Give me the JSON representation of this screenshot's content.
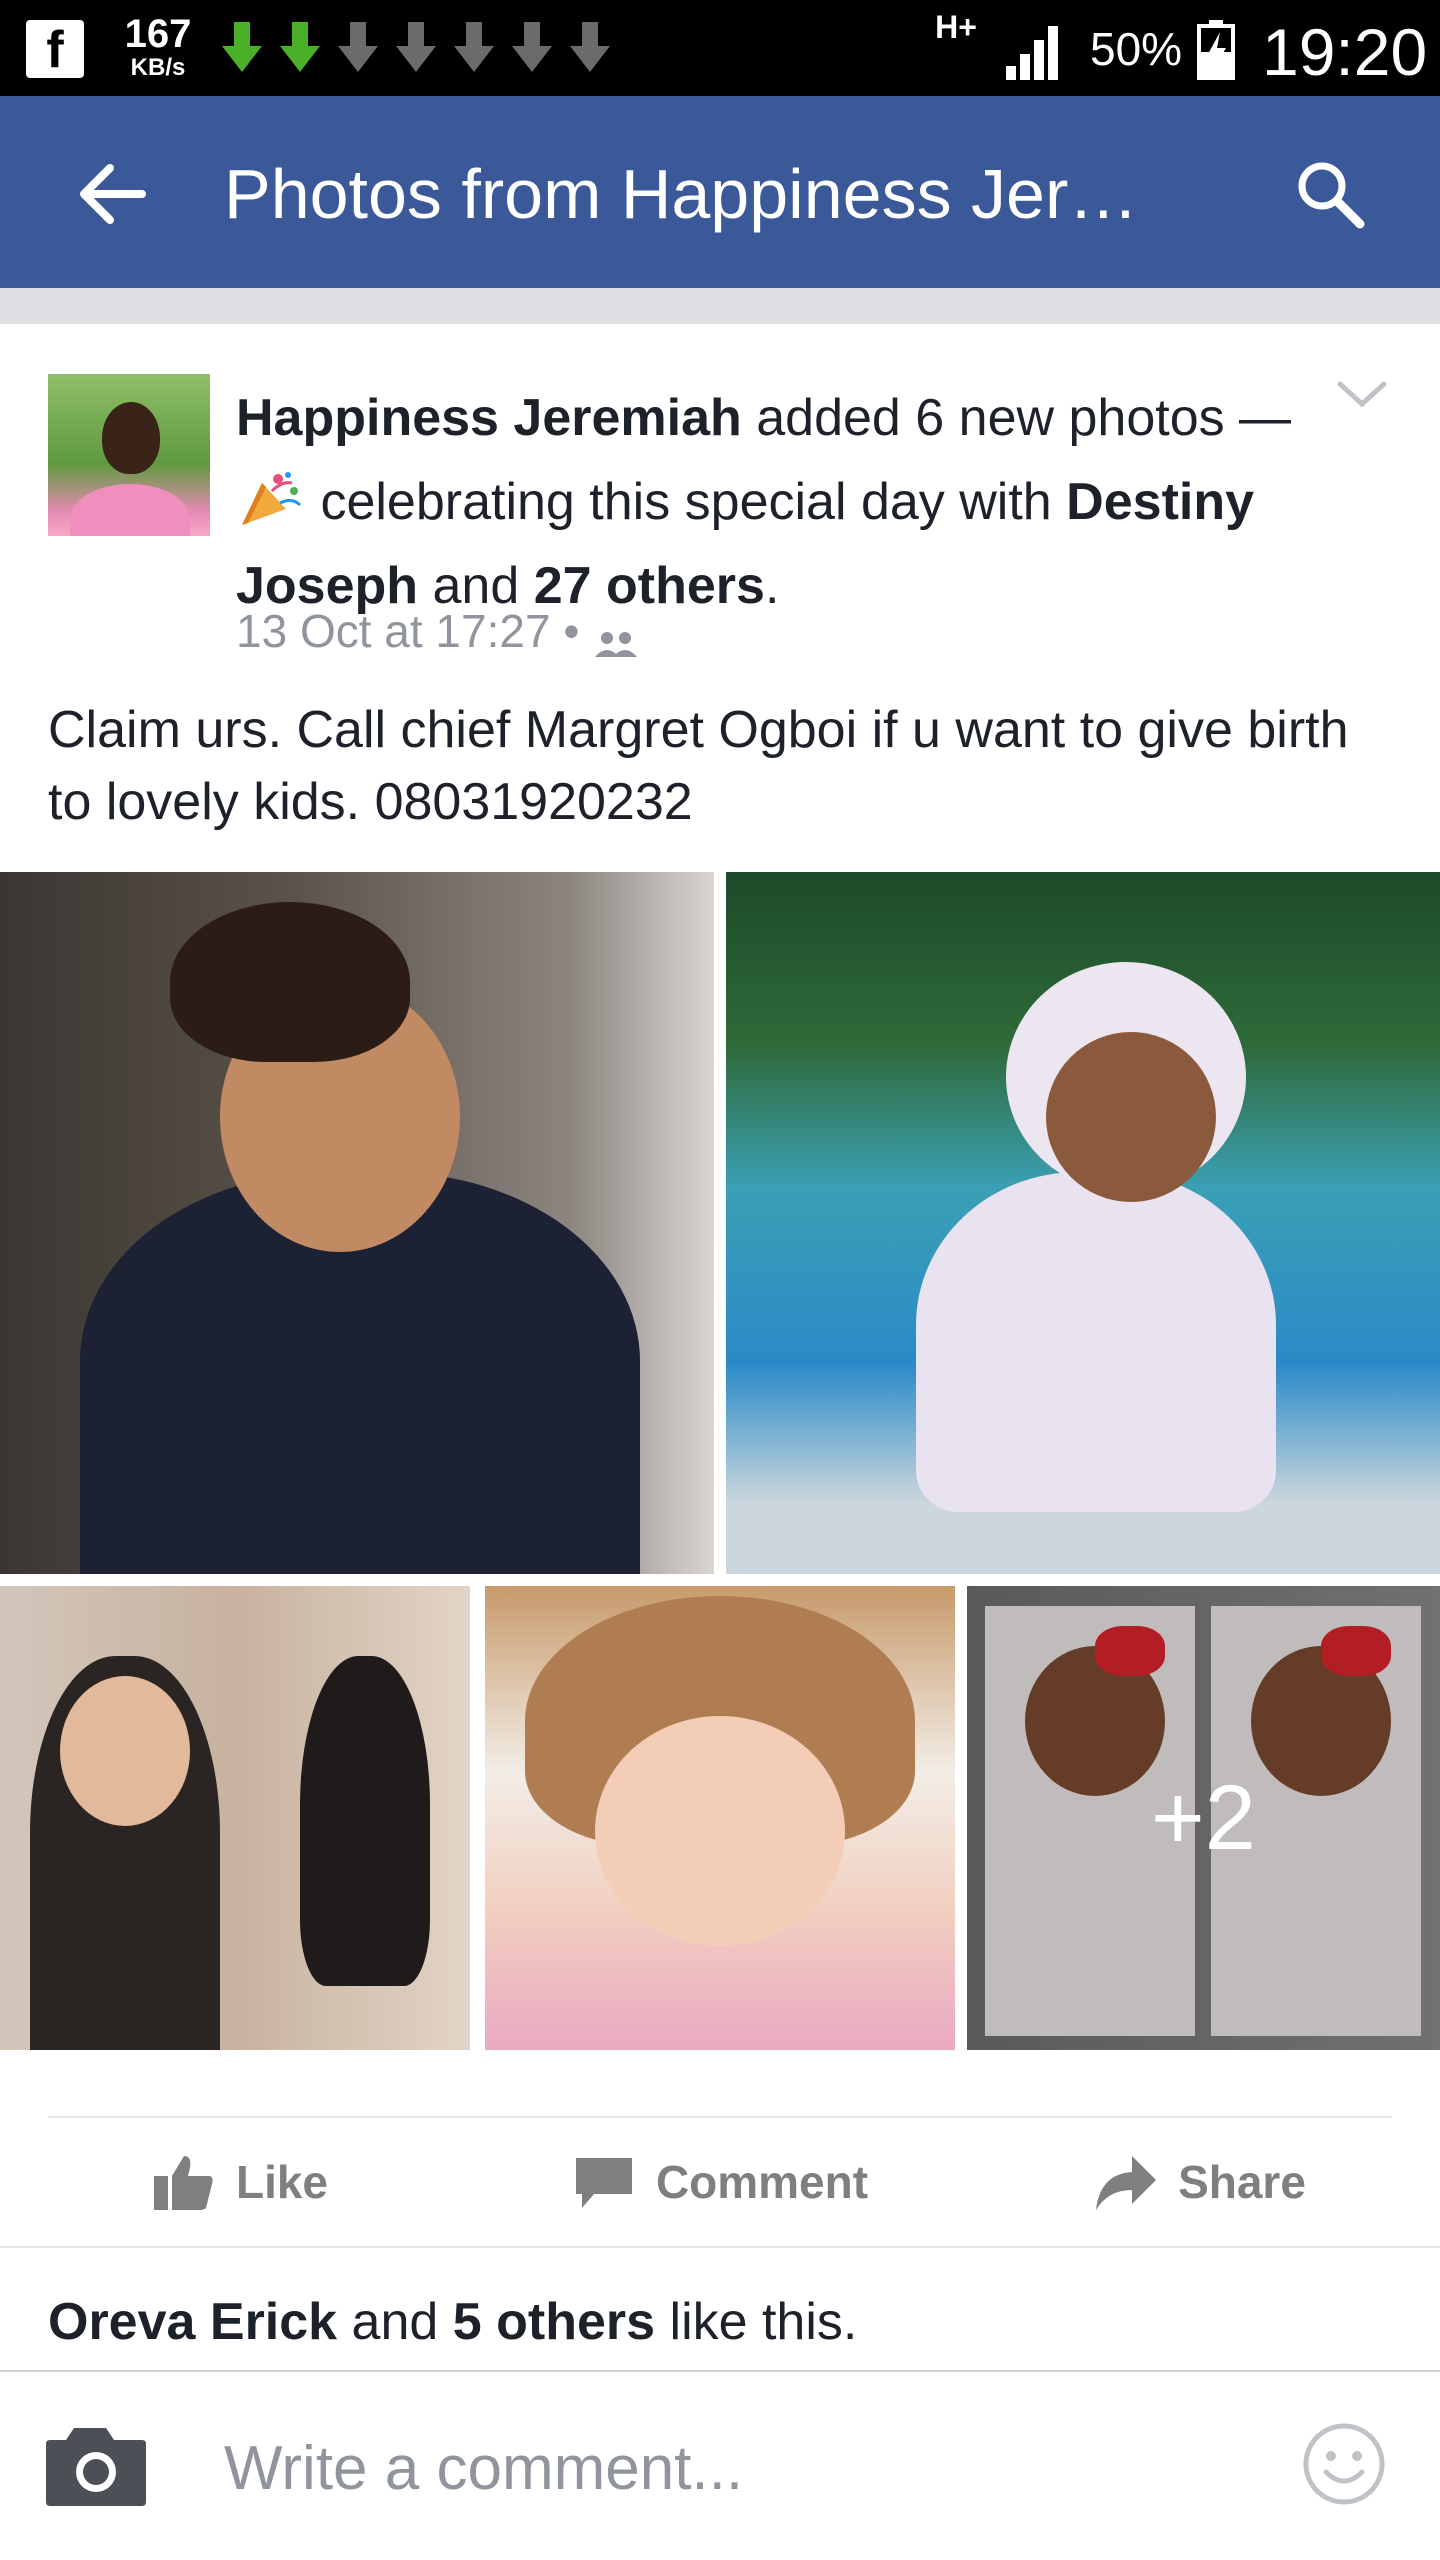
{
  "status_bar": {
    "fb_icon": "f",
    "speed_value": "167",
    "speed_unit": "KB/s",
    "network_type": "H+",
    "battery_percent": "50%",
    "time": "19:20",
    "download_arrows": [
      "green",
      "green",
      "gray",
      "gray",
      "gray",
      "gray",
      "gray"
    ],
    "accent_green": "#4caf28",
    "dim_gray": "#6b6b6b"
  },
  "app_bar": {
    "title": "Photos from Happiness Jer…",
    "back_icon": "arrow-left-icon",
    "search_icon": "search-icon",
    "background": "#3b5998"
  },
  "post": {
    "author": "Happiness Jeremiah",
    "action_text": " added 6 new photos — ",
    "feeling_icon": "party-popper-icon",
    "feeling_text": " celebrating this special day with ",
    "tagged_person": "Destiny Joseph",
    "and_text": " and ",
    "others": "27 others",
    "period": ".",
    "timestamp": "13 Oct at 17:27 •",
    "audience_icon": "friends-icon",
    "body": "Claim urs. Call chief Margret Ogboi if u want to give birth to lovely kids. 08031920232",
    "more_photos_label": "+2"
  },
  "actions": {
    "like_label": "Like",
    "comment_label": "Comment",
    "share_label": "Share"
  },
  "likes_summary": {
    "first_liker": "Oreva Erick",
    "and_text": " and ",
    "others": "5 others",
    "suffix": " like this."
  },
  "comment_bar": {
    "placeholder": "Write a comment...",
    "camera_icon": "camera-icon",
    "emoji_icon": "smiley-icon"
  }
}
